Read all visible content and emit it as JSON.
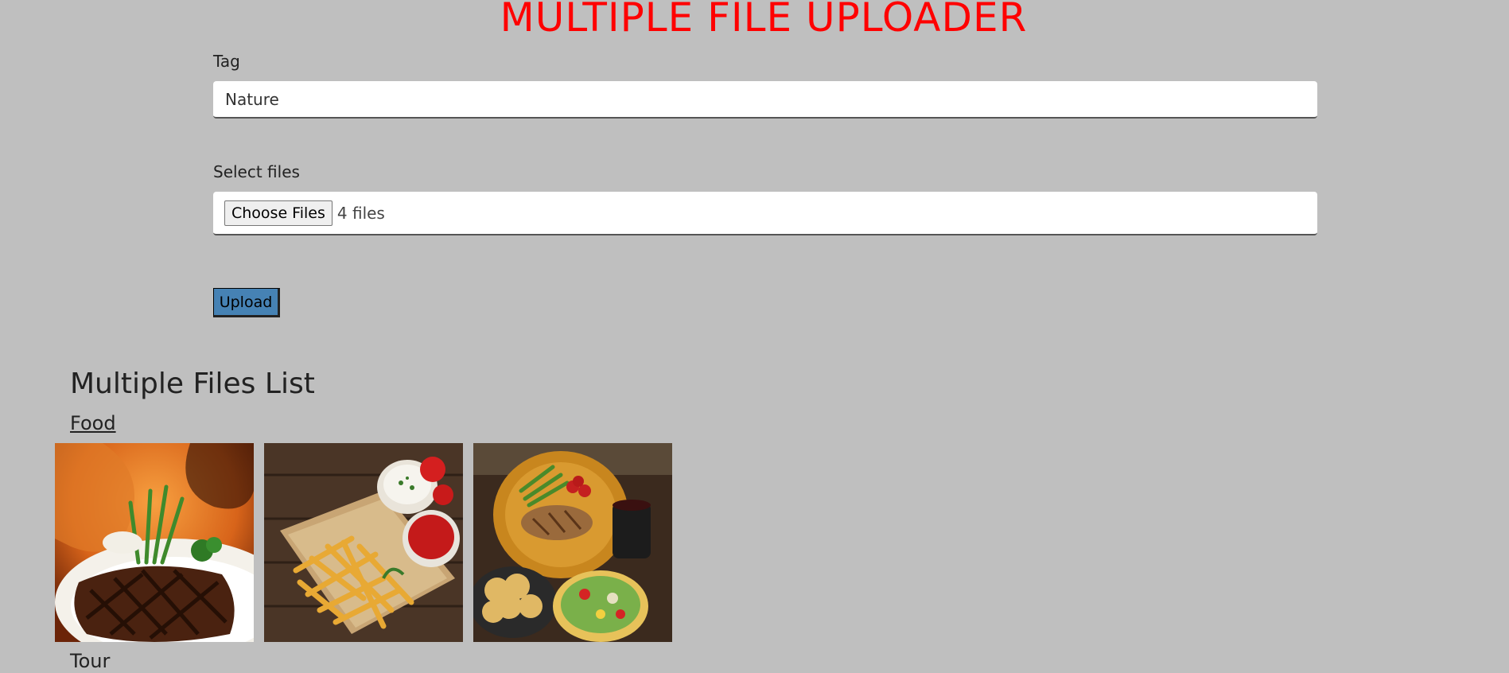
{
  "page": {
    "title": "MULTIPLE FILE UPLOADER"
  },
  "form": {
    "tag_label": "Tag",
    "tag_value": "Nature",
    "files_label": "Select files",
    "choose_button": "Choose Files",
    "files_status": "4 files",
    "upload_button": "Upload"
  },
  "list": {
    "title": "Multiple Files List",
    "groups": [
      {
        "name": "Food",
        "images": [
          {
            "icon": "steak-plate-image"
          },
          {
            "icon": "french-fries-image"
          },
          {
            "icon": "grilled-fish-platter-image"
          }
        ]
      },
      {
        "name": "Tour"
      }
    ]
  },
  "colors": {
    "background": "#bfbfbf",
    "title": "#ff0000",
    "upload_button": "#4682b4"
  }
}
